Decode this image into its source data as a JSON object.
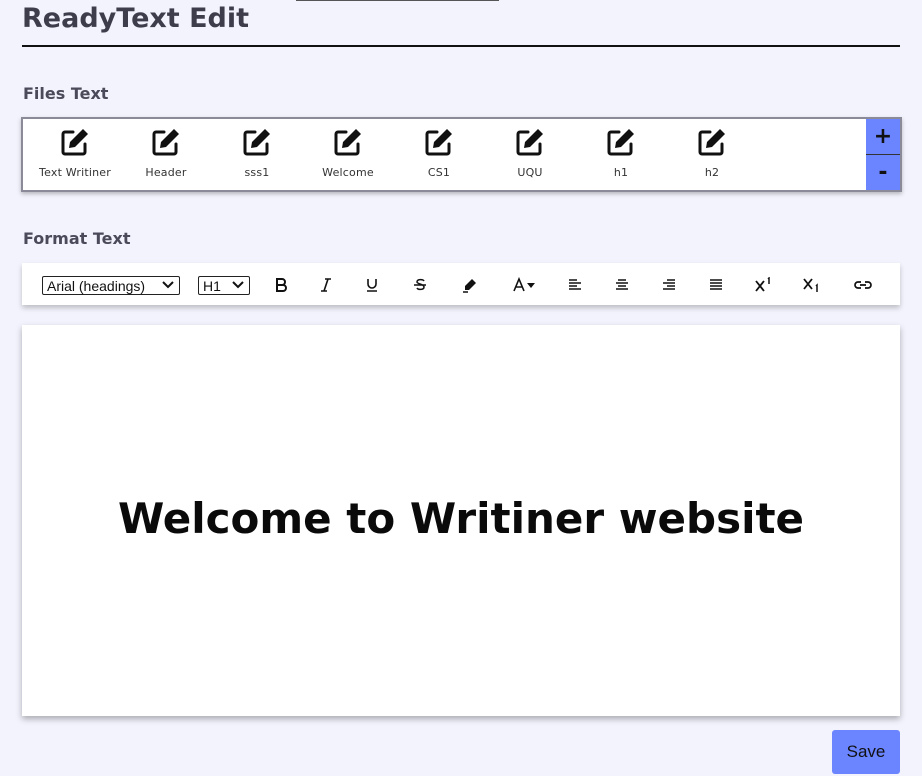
{
  "app": {
    "title": "ReadyText Edit"
  },
  "files": {
    "section_label": "Files Text",
    "items": [
      {
        "label": "Text Writiner",
        "icon": "edit-icon"
      },
      {
        "label": "Header",
        "icon": "edit-icon"
      },
      {
        "label": "sss1",
        "icon": "edit-icon"
      },
      {
        "label": "Welcome",
        "icon": "edit-icon"
      },
      {
        "label": "CS1",
        "icon": "edit-icon"
      },
      {
        "label": "UQU",
        "icon": "edit-icon"
      },
      {
        "label": "h1",
        "icon": "edit-icon"
      },
      {
        "label": "h2",
        "icon": "edit-icon"
      }
    ],
    "add_label": "+",
    "remove_label": "-"
  },
  "format": {
    "section_label": "Format Text",
    "font_select": "Arial (headings)",
    "heading_select": "H1",
    "tools": [
      "bold-icon",
      "italic-icon",
      "underline-icon",
      "strikethrough-icon",
      "highlighter-icon",
      "font-color-icon",
      "align-left-icon",
      "align-center-icon",
      "align-right-icon",
      "align-justify-icon",
      "superscript-icon",
      "subscript-icon",
      "link-icon"
    ]
  },
  "editor": {
    "content": "Welcome to Writiner website"
  },
  "actions": {
    "save_label": "Save"
  },
  "colors": {
    "accent": "#6b84ff",
    "background": "#f3f3fd"
  }
}
